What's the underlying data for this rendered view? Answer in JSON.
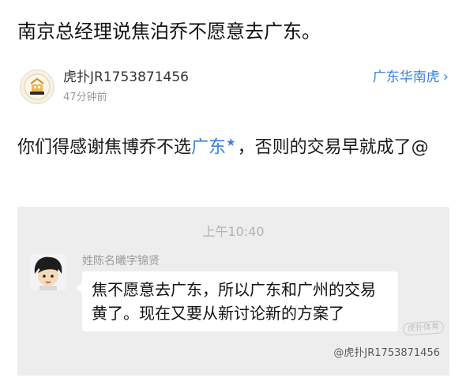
{
  "post": {
    "title": "南京总经理说焦泊乔不愿意去广东。",
    "author": "虎扑JR1753871456",
    "time": "47分钟前",
    "forum_link": "广东华南虎",
    "body_before": "你们得感谢焦博乔不选",
    "body_tag": "广东",
    "body_after": "，否则的交易早就成了@"
  },
  "screenshot": {
    "time": "上午10:40",
    "sender": "姓陈名曦字锦贤",
    "message": "焦不愿意去广东，所以广东和广州的交易黄了。现在又要从新讨论新的方案了",
    "stamp": "虎扑体育",
    "watermark": "@虎扑JR1753871456"
  },
  "icons": {
    "author_avatar": "hupu-logo-icon",
    "forum_link_arrow": "chevron-right-icon",
    "tag_marker": "star-icon",
    "chat_avatar": "cartoon-boy-avatar-icon"
  },
  "colors": {
    "link": "#3a82d8",
    "screenshot_bg": "#ededed"
  }
}
